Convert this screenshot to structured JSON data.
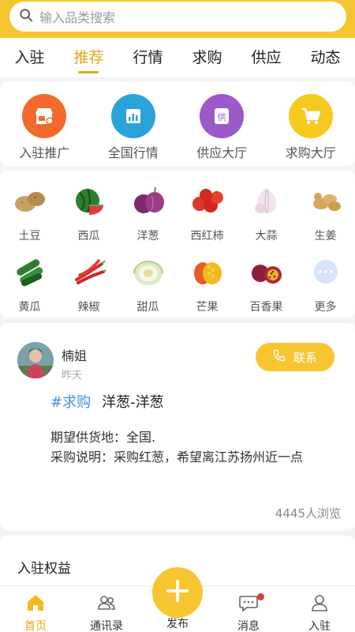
{
  "search": {
    "placeholder": "输入品类搜索"
  },
  "tabs": [
    {
      "label": "入驻"
    },
    {
      "label": "推荐",
      "active": true
    },
    {
      "label": "行情"
    },
    {
      "label": "求购"
    },
    {
      "label": "供应"
    },
    {
      "label": "动态"
    }
  ],
  "quick_entries": [
    {
      "label": "入驻推广",
      "icon": "shop-icon",
      "color": "#f26b2a"
    },
    {
      "label": "全国行情",
      "icon": "chart-icon",
      "color": "#29a3d8"
    },
    {
      "label": "供应大厅",
      "icon": "supply-icon",
      "color": "#9b59c9",
      "glyph": "供"
    },
    {
      "label": "求购大厅",
      "icon": "cart-icon",
      "color": "#f7c81e"
    }
  ],
  "categories": [
    {
      "label": "土豆"
    },
    {
      "label": "西瓜"
    },
    {
      "label": "洋葱"
    },
    {
      "label": "西红柿"
    },
    {
      "label": "大蒜"
    },
    {
      "label": "生姜"
    },
    {
      "label": "黄瓜"
    },
    {
      "label": "辣椒"
    },
    {
      "label": "甜瓜"
    },
    {
      "label": "芒果"
    },
    {
      "label": "百香果"
    },
    {
      "label": "更多"
    }
  ],
  "post": {
    "user": "楠姐",
    "time": "昨天",
    "contact_label": "联系",
    "tag": "#求购",
    "title": "洋葱-洋葱",
    "line1": "期望供货地：全国.",
    "line2": "采购说明：采购红葱，希望离江苏扬州近一点",
    "views": "4445人浏览"
  },
  "benefit": {
    "title": "入驻权益"
  },
  "tabbar": {
    "home": "首页",
    "contacts": "通讯录",
    "publish": "发布",
    "messages": "消息",
    "join": "入驻"
  },
  "colors": {
    "accent": "#f7c530",
    "active_text": "#e5a817",
    "tag": "#3d8fe0"
  }
}
